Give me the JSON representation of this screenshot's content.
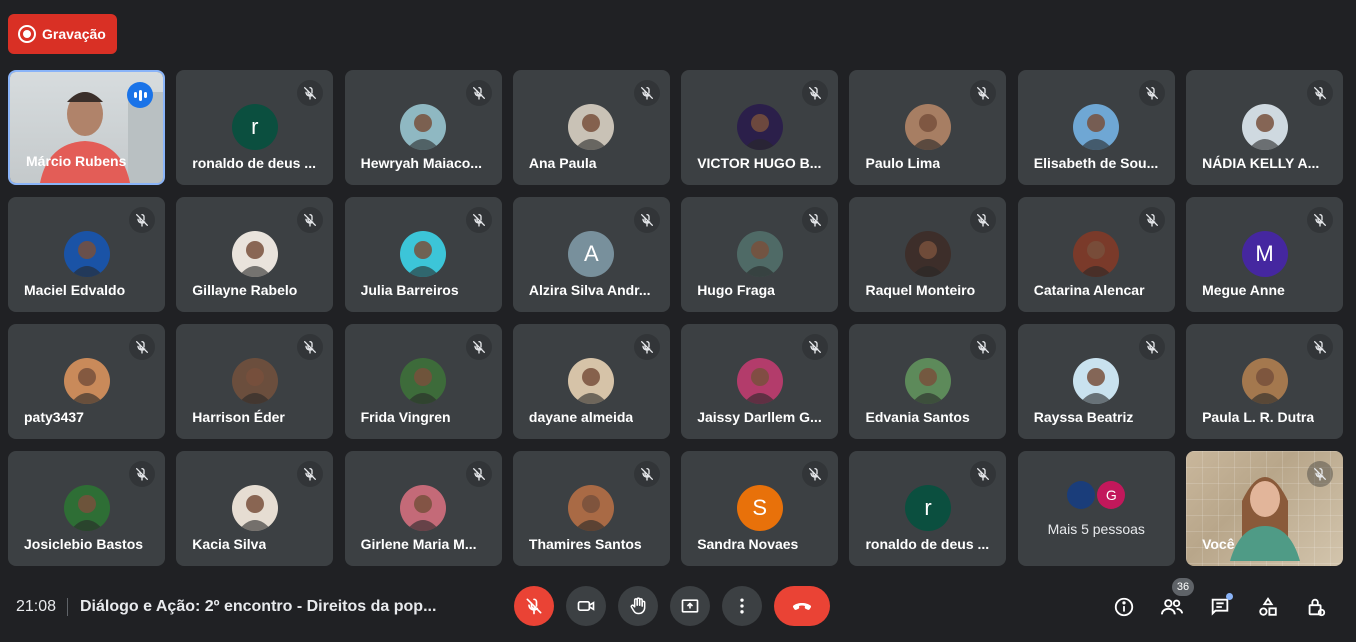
{
  "recording": {
    "label": "Gravação"
  },
  "participants": [
    {
      "name": "Márcio Rubens",
      "avatar_type": "video"
    },
    {
      "name": "ronaldo de deus ...",
      "initial": "r",
      "color": "#0b4f3f"
    },
    {
      "name": "Hewryah Maiaco...",
      "color": "#8fb8c2"
    },
    {
      "name": "Ana Paula",
      "color": "#c9c2b6"
    },
    {
      "name": "VICTOR HUGO B...",
      "color": "#2b1f4a"
    },
    {
      "name": "Paulo Lima",
      "color": "#a77e63"
    },
    {
      "name": "Elisabeth de Sou...",
      "color": "#6fa7d4"
    },
    {
      "name": "NÁDIA KELLY A...",
      "color": "#cfd9e0"
    },
    {
      "name": "Maciel Edvaldo",
      "color": "#1a53a6"
    },
    {
      "name": "Gillayne Rabelo",
      "color": "#e9e3dc"
    },
    {
      "name": "Julia Barreiros",
      "color": "#3cc5d8"
    },
    {
      "name": "Alzira Silva Andr...",
      "initial": "A",
      "color": "#78909c"
    },
    {
      "name": "Hugo Fraga",
      "color": "#4f6a66"
    },
    {
      "name": "Raquel Monteiro",
      "color": "#3d2e2a"
    },
    {
      "name": "Catarina Alencar",
      "color": "#7a3a2a"
    },
    {
      "name": "Megue Anne",
      "initial": "M",
      "color": "#4527a0"
    },
    {
      "name": "paty3437",
      "color": "#c98a5a"
    },
    {
      "name": "Harrison Éder",
      "color": "#6b4e3d"
    },
    {
      "name": "Frida Vingren",
      "color": "#3d6b3a"
    },
    {
      "name": "dayane almeida",
      "color": "#d6c3a8"
    },
    {
      "name": "Jaissy Darllem G...",
      "color": "#b33c6b"
    },
    {
      "name": "Edvania Santos",
      "color": "#5d8a5a"
    },
    {
      "name": "Rayssa Beatriz",
      "color": "#c9e2ef"
    },
    {
      "name": "Paula L. R. Dutra",
      "color": "#a4784e"
    },
    {
      "name": "Josiclebio Bastos",
      "color": "#2e6e35"
    },
    {
      "name": "Kacia Silva",
      "color": "#e6ddd2"
    },
    {
      "name": "Girlene Maria M...",
      "color": "#c46a78"
    },
    {
      "name": "Thamires Santos",
      "color": "#a96a45"
    },
    {
      "name": "Sandra Novaes",
      "initial": "S",
      "color": "#e8710a"
    },
    {
      "name": "ronaldo de deus ...",
      "initial": "r",
      "color": "#0b4f3f"
    }
  ],
  "more": {
    "label": "Mais 5 pessoas",
    "avatars": [
      {
        "initial": "",
        "color": "#1a3d7a"
      },
      {
        "initial": "G",
        "color": "#c2185b"
      }
    ]
  },
  "self": {
    "name": "Você"
  },
  "footer": {
    "time": "21:08",
    "meeting_title": "Diálogo e Ação: 2º encontro - Direitos da pop...",
    "participant_count": "36"
  },
  "colors": {
    "background": "#202124",
    "tile": "#3c4043",
    "recording": "#d93025",
    "hangup": "#ea4335",
    "active_border": "#8ab4f8"
  }
}
